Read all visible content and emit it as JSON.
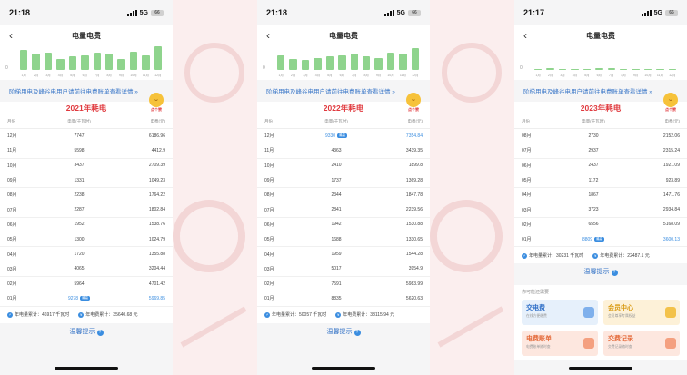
{
  "screens": [
    {
      "status": {
        "time": "21:18",
        "network": "5G",
        "battery": "66"
      },
      "nav": {
        "title": "电量电费"
      },
      "chart": {
        "y0": "0",
        "months": [
          "1月",
          "2月",
          "3月",
          "4月",
          "5月",
          "6月",
          "7月",
          "8月",
          "9月",
          "10月",
          "11月",
          "12月"
        ],
        "fill": [
          0.8,
          0.65,
          0.7,
          0.45,
          0.55,
          0.6,
          0.7,
          0.65,
          0.45,
          0.75,
          0.6,
          0.95
        ]
      },
      "tier_link": "阶梯用电及峰谷电用户请前往电费账单查看详情 »",
      "year_title": "2021年耗电",
      "mascot_tag": "点个赞",
      "headers": {
        "month": "月份",
        "kwh": "电量(千瓦时)",
        "fee": "电费(元)"
      },
      "rows": [
        {
          "month": "12月",
          "kwh": "7747",
          "fee": "6186.96",
          "max": false
        },
        {
          "month": "11月",
          "kwh": "5598",
          "fee": "4412.9",
          "max": false
        },
        {
          "month": "10月",
          "kwh": "3437",
          "fee": "2709.39",
          "max": false
        },
        {
          "month": "09月",
          "kwh": "1331",
          "fee": "1049.23",
          "max": false
        },
        {
          "month": "08月",
          "kwh": "2238",
          "fee": "1764.22",
          "max": false
        },
        {
          "month": "07月",
          "kwh": "2287",
          "fee": "1802.84",
          "max": false
        },
        {
          "month": "06月",
          "kwh": "1952",
          "fee": "1538.76",
          "max": false
        },
        {
          "month": "05月",
          "kwh": "1300",
          "fee": "1024.79",
          "max": false
        },
        {
          "month": "04月",
          "kwh": "1720",
          "fee": "1355.88",
          "max": false
        },
        {
          "month": "03月",
          "kwh": "4065",
          "fee": "3204.44",
          "max": false
        },
        {
          "month": "02月",
          "kwh": "5964",
          "fee": "4701.42",
          "max": false
        },
        {
          "month": "01月",
          "kwh": "9278",
          "fee": "5969.85",
          "max": true
        }
      ],
      "max_tag": "最高",
      "totals": {
        "kwh": "年电量累计：46917 千瓦时",
        "fee": "年电费累计：35640.68 元"
      },
      "tip": "温馨提示"
    },
    {
      "status": {
        "time": "21:18",
        "network": "5G",
        "battery": "66"
      },
      "nav": {
        "title": "电量电费"
      },
      "chart": {
        "y0": "0",
        "months": [
          "1月",
          "2月",
          "3月",
          "4月",
          "5月",
          "6月",
          "7月",
          "8月",
          "9月",
          "10月",
          "11月",
          "12月"
        ],
        "fill": [
          0.6,
          0.45,
          0.4,
          0.5,
          0.55,
          0.6,
          0.65,
          0.55,
          0.5,
          0.7,
          0.65,
          0.9
        ]
      },
      "tier_link": "阶梯用电及峰谷电用户请前往电费账单查看详情 »",
      "year_title": "2022年耗电",
      "mascot_tag": "点个赞",
      "headers": {
        "month": "月份",
        "kwh": "电量(千瓦时)",
        "fee": "电费(元)"
      },
      "rows": [
        {
          "month": "12月",
          "kwh": "9330",
          "fee": "7354.84",
          "max": true
        },
        {
          "month": "11月",
          "kwh": "4363",
          "fee": "3439.35",
          "max": false
        },
        {
          "month": "10月",
          "kwh": "2410",
          "fee": "1899.8",
          "max": false
        },
        {
          "month": "09月",
          "kwh": "1737",
          "fee": "1369.28",
          "max": false
        },
        {
          "month": "08月",
          "kwh": "2344",
          "fee": "1847.78",
          "max": false
        },
        {
          "month": "07月",
          "kwh": "2841",
          "fee": "2239.56",
          "max": false
        },
        {
          "month": "06月",
          "kwh": "1942",
          "fee": "1530.88",
          "max": false
        },
        {
          "month": "05月",
          "kwh": "1688",
          "fee": "1330.65",
          "max": false
        },
        {
          "month": "04月",
          "kwh": "1959",
          "fee": "1544.28",
          "max": false
        },
        {
          "month": "03月",
          "kwh": "5017",
          "fee": "3954.9",
          "max": false
        },
        {
          "month": "02月",
          "kwh": "7591",
          "fee": "5983.99",
          "max": false
        },
        {
          "month": "01月",
          "kwh": "8835",
          "fee": "5620.63",
          "max": false
        }
      ],
      "max_tag": "最高",
      "totals": {
        "kwh": "年电量累计：50057 千瓦时",
        "fee": "年电费累计：38115.94 元"
      },
      "tip": "温馨提示"
    },
    {
      "status": {
        "time": "21:17",
        "network": "5G",
        "battery": "66"
      },
      "nav": {
        "title": "电量电费"
      },
      "chart": {
        "y0": "0",
        "months": [
          "1月",
          "2月",
          "3月",
          "4月",
          "5月",
          "6月",
          "7月",
          "8月",
          "9月",
          "10月",
          "11月",
          "12月"
        ],
        "fill": [
          0.05,
          0.06,
          0.05,
          0.04,
          0.05,
          0.06,
          0.06,
          0.05,
          0,
          0,
          0,
          0
        ]
      },
      "tier_link": "阶梯用电及峰谷电用户请前往电费账单查看详情 »",
      "year_title": "2023年耗电",
      "mascot_tag": "点个赞",
      "headers": {
        "month": "月份",
        "kwh": "电量(千瓦时)",
        "fee": "电费(元)"
      },
      "rows": [
        {
          "month": "08月",
          "kwh": "2730",
          "fee": "2152.06",
          "max": false
        },
        {
          "month": "07月",
          "kwh": "2937",
          "fee": "2315.24",
          "max": false
        },
        {
          "month": "06月",
          "kwh": "2437",
          "fee": "1921.09",
          "max": false
        },
        {
          "month": "05月",
          "kwh": "1172",
          "fee": "923.89",
          "max": false
        },
        {
          "month": "04月",
          "kwh": "1867",
          "fee": "1471.76",
          "max": false
        },
        {
          "month": "03月",
          "kwh": "3723",
          "fee": "2934.84",
          "max": false
        },
        {
          "month": "02月",
          "kwh": "6556",
          "fee": "5168.09",
          "max": false
        },
        {
          "month": "01月",
          "kwh": "8809",
          "fee": "3600.13",
          "max": true
        }
      ],
      "max_tag": "最高",
      "totals": {
        "kwh": "年电量累计：30231 千瓦时",
        "fee": "年电费累计：22487.1 元"
      },
      "tip": "温馨提示",
      "needs": {
        "label": "你可能还需要",
        "cards": [
          {
            "title": "交电费",
            "sub": "在线方便缴费",
            "style": "cb"
          },
          {
            "title": "会员中心",
            "sub": "会员尊享专属权益",
            "style": "cy"
          },
          {
            "title": "电费账单",
            "sub": "电费账单随时查",
            "style": "co"
          },
          {
            "title": "交费记录",
            "sub": "交费记录随时查",
            "style": "cp"
          }
        ]
      }
    }
  ]
}
